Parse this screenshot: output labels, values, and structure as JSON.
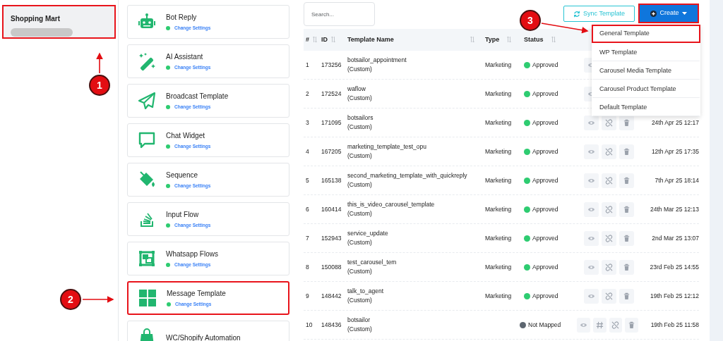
{
  "account": {
    "name": "Shopping Mart",
    "highlighted": true
  },
  "features": [
    {
      "title": "Bot Reply",
      "link": "Change Settings",
      "highlighted": false
    },
    {
      "title": "AI Assistant",
      "link": "Change Settings",
      "highlighted": false
    },
    {
      "title": "Broadcast Template",
      "link": "Change Settings",
      "highlighted": false
    },
    {
      "title": "Chat Widget",
      "link": "Change Settings",
      "highlighted": false
    },
    {
      "title": "Sequence",
      "link": "Change Settings",
      "highlighted": false
    },
    {
      "title": "Input Flow",
      "link": "Change Settings",
      "highlighted": false
    },
    {
      "title": "Whatsapp Flows",
      "link": "Change Settings",
      "highlighted": false
    },
    {
      "title": "Message Template",
      "link": "Change Settings",
      "highlighted": true
    },
    {
      "title": "WC/Shopify Automation",
      "highlighted": false
    }
  ],
  "search": {
    "placeholder": "Search..."
  },
  "sync_button": {
    "label": "Sync Template"
  },
  "create_button": {
    "label": "Create",
    "highlighted": true,
    "expanded": true
  },
  "create_menu": [
    {
      "label": "General Template",
      "highlighted": true
    },
    {
      "label": "WP Template",
      "highlighted": false
    },
    {
      "label": "Carousel Media Template",
      "highlighted": false
    },
    {
      "label": "Carousel Product Template",
      "highlighted": false
    },
    {
      "label": "Default Template",
      "highlighted": false
    }
  ],
  "table": {
    "columns": [
      "#",
      "ID",
      "Template Name",
      "Type",
      "Status"
    ],
    "rows": [
      {
        "num": "1",
        "id": "173256",
        "name": "botsailor_appointment",
        "source": "(Custom)",
        "type": "Marketing",
        "status": "Approved",
        "color": "#2ecc71",
        "kind": "mapped"
      },
      {
        "num": "2",
        "id": "172524",
        "name": "waflow",
        "source": "(Custom)",
        "type": "Marketing",
        "status": "Approved",
        "color": "#2ecc71",
        "kind": "mapped"
      },
      {
        "num": "3",
        "id": "171095",
        "name": "botsailors",
        "source": "(Custom)",
        "type": "Marketing",
        "status": "Approved",
        "color": "#2ecc71",
        "kind": "mapped",
        "date": "24th Apr 25 12:17"
      },
      {
        "num": "4",
        "id": "167205",
        "name": "marketing_template_test_opu",
        "source": "(Custom)",
        "type": "Marketing",
        "status": "Approved",
        "color": "#2ecc71",
        "kind": "mapped",
        "date": "12th Apr 25 17:35"
      },
      {
        "num": "5",
        "id": "165138",
        "name": "second_marketing_template_with_quickreply",
        "source": "(Custom)",
        "type": "Marketing",
        "status": "Approved",
        "color": "#2ecc71",
        "kind": "mapped",
        "date": "7th Apr 25 18:14"
      },
      {
        "num": "6",
        "id": "160414",
        "name": "this_is_video_carousel_template",
        "source": "(Custom)",
        "type": "Marketing",
        "status": "Approved",
        "color": "#2ecc71",
        "kind": "mapped",
        "date": "24th Mar 25 12:13"
      },
      {
        "num": "7",
        "id": "152943",
        "name": "service_update",
        "source": "(Custom)",
        "type": "Marketing",
        "status": "Approved",
        "color": "#2ecc71",
        "kind": "mapped",
        "date": "2nd Mar 25 13:07"
      },
      {
        "num": "8",
        "id": "150088",
        "name": "test_carousel_tem",
        "source": "(Custom)",
        "type": "Marketing",
        "status": "Approved",
        "color": "#2ecc71",
        "kind": "mapped",
        "date": "23rd Feb 25 14:55"
      },
      {
        "num": "9",
        "id": "148442",
        "name": "talk_to_agent",
        "source": "(Custom)",
        "type": "Marketing",
        "status": "Approved",
        "color": "#2ecc71",
        "kind": "mapped",
        "date": "19th Feb 25 12:12"
      },
      {
        "num": "10",
        "id": "148436",
        "name": "botsailor",
        "source": "(Custom)",
        "status": "Not Mapped",
        "color": "#5d6670",
        "kind": "unmapped",
        "date": "19th Feb 25 11:58"
      }
    ]
  },
  "callouts": [
    {
      "number": "1",
      "kind": "account"
    },
    {
      "number": "2",
      "kind": "feature"
    },
    {
      "number": "3",
      "kind": "menu"
    }
  ]
}
